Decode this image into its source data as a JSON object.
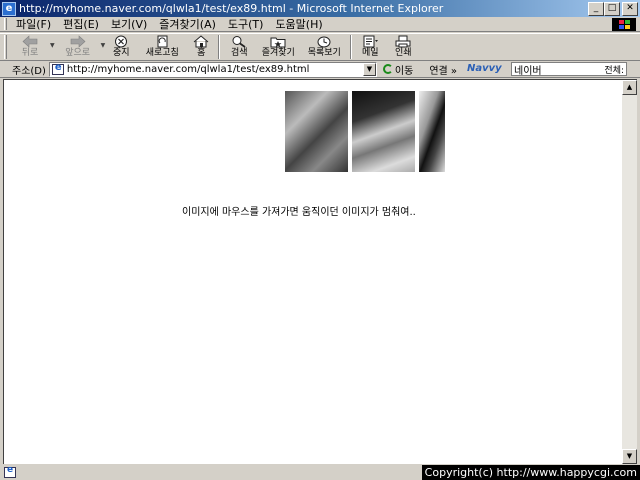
{
  "window": {
    "title": "http://myhome.naver.com/qlwla1/test/ex89.html - Microsoft Internet Explorer"
  },
  "menu": [
    "파일(F)",
    "편집(E)",
    "보기(V)",
    "즐겨찾기(A)",
    "도구(T)",
    "도움말(H)"
  ],
  "toolbar": {
    "back": "뒤로",
    "forward": "앞으로",
    "stop": "중지",
    "refresh": "새로고침",
    "home": "홈",
    "search": "검색",
    "favorites": "즐겨찾기",
    "history": "목록보기",
    "mail": "메일",
    "print": "인쇄"
  },
  "address": {
    "label": "주소(D)",
    "url": "http://myhome.naver.com/qlwla1/test/ex89.html",
    "go": "이동",
    "links": "연결 »"
  },
  "search_bar": {
    "brand": "Navvy",
    "value": "네이버",
    "scope": "전체:"
  },
  "content": {
    "caption": "이미지에 마우스를 가져가면 움직이던 이미지가 멈춰여.."
  },
  "status": {
    "copyright": "Copyright(c) http://www.happycgi.com"
  },
  "colors": {
    "titlebar_start": "#0a246a",
    "titlebar_end": "#a6caf0",
    "chrome": "#d4d0c8"
  }
}
